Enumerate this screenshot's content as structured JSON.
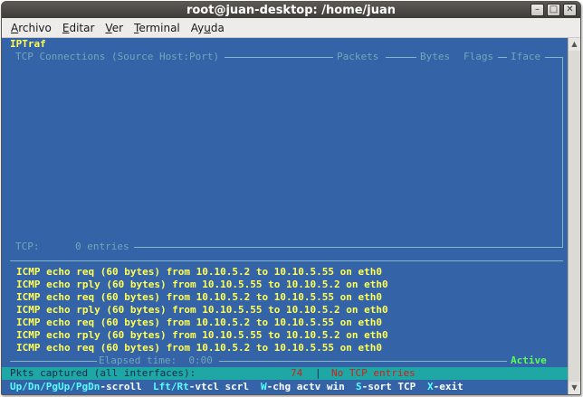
{
  "window": {
    "title": "root@juan-desktop: /home/juan",
    "buttons": {
      "minimize": "–",
      "maximize": "□",
      "close": "✕"
    }
  },
  "menubar": {
    "items": [
      {
        "underlined": "A",
        "rest": "rchivo"
      },
      {
        "underlined": "E",
        "rest": "ditar"
      },
      {
        "underlined": "V",
        "rest": "er"
      },
      {
        "underlined": "T",
        "rest": "erminal"
      },
      {
        "pre": "Ay",
        "underlined": "u",
        "rest": "da"
      }
    ]
  },
  "terminal": {
    "app_name": "IPTraf",
    "header": {
      "connections": "TCP Connections (Source Host:Port)",
      "packets": "Packets",
      "bytes": "Bytes",
      "flags": "Flags",
      "iface": "Iface"
    },
    "tcp_status": {
      "label": "TCP:",
      "count": "0 entries"
    },
    "icmp_lines": [
      "ICMP echo req (60 bytes) from 10.10.5.2 to 10.10.5.55 on eth0",
      "ICMP echo rply (60 bytes) from 10.10.5.55 to 10.10.5.2 on eth0",
      "ICMP echo req (60 bytes) from 10.10.5.2 to 10.10.5.55 on eth0",
      "ICMP echo rply (60 bytes) from 10.10.5.55 to 10.10.5.2 on eth0",
      "ICMP echo req (60 bytes) from 10.10.5.2 to 10.10.5.55 on eth0",
      "ICMP echo rply (60 bytes) from 10.10.5.55 to 10.10.5.2 on eth0",
      "ICMP echo req (60 bytes) from 10.10.5.2 to 10.10.5.55 on eth0"
    ],
    "elapsed": "Elapsed time:  0:00",
    "active": "Active",
    "status": {
      "pkts_label": "Pkts captured (all interfaces):",
      "pkts_count": "74",
      "separator": "|",
      "no_tcp": "No TCP entries"
    },
    "keys": [
      {
        "key": "Up/Dn/PgUp/PgDn",
        "desc": "-scroll"
      },
      {
        "key": "Lft/Rt",
        "desc": "-vtcl scrl"
      },
      {
        "key": "W",
        "desc": "-chg actv win"
      },
      {
        "key": "S",
        "desc": "-sort TCP"
      },
      {
        "key": "X",
        "desc": "-exit"
      }
    ]
  },
  "colors": {
    "terminal_bg": "#3563a8",
    "highlight_yellow": "#ffff55",
    "status_bg": "#1fa7a6",
    "key_cyan": "#55ffff",
    "active_green": "#55ff55",
    "alert_red": "#cc2020"
  }
}
